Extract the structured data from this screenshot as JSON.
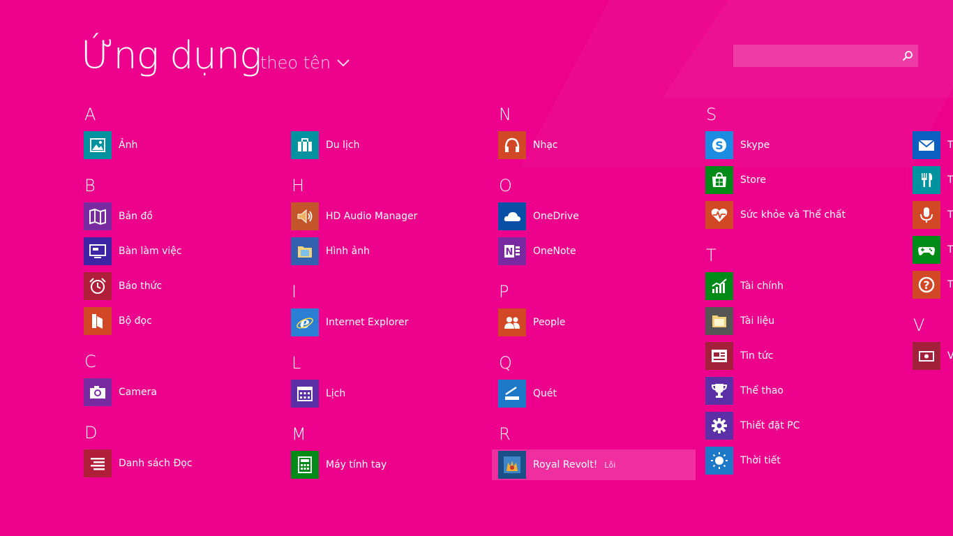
{
  "header": {
    "title": "Ứng dụng",
    "sort_label": "theo tên"
  },
  "search": {
    "value": "",
    "placeholder": ""
  },
  "columns": [
    {
      "groups": [
        {
          "letter": "A",
          "apps": [
            {
              "label": "Ảnh",
              "icon": "photos-icon",
              "color": "#00939f"
            }
          ]
        },
        {
          "letter": "B",
          "apps": [
            {
              "label": "Bản đồ",
              "icon": "maps-icon",
              "color": "#7a2aa0"
            },
            {
              "label": "Bàn làm việc",
              "icon": "desktop-icon",
              "color": "#3d24a4"
            },
            {
              "label": "Báo thức",
              "icon": "alarm-icon",
              "color": "#b01e3a"
            },
            {
              "label": "Bộ đọc",
              "icon": "reader-icon",
              "color": "#d24726"
            }
          ]
        },
        {
          "letter": "C",
          "apps": [
            {
              "label": "Camera",
              "icon": "camera-icon",
              "color": "#7a2aa0"
            }
          ]
        },
        {
          "letter": "D",
          "apps": [
            {
              "label": "Danh sách Đọc",
              "icon": "reading-list-icon",
              "color": "#b01e3a"
            }
          ]
        }
      ]
    },
    {
      "groups": [
        {
          "letter": "",
          "apps": [
            {
              "label": "Du lịch",
              "icon": "travel-icon",
              "color": "#00939f"
            }
          ]
        },
        {
          "letter": "H",
          "apps": [
            {
              "label": "HD Audio Manager",
              "icon": "speaker-icon",
              "color": "#c4542a"
            },
            {
              "label": "Hình ảnh",
              "icon": "pictures-folder-icon",
              "color": "#3361b0"
            }
          ]
        },
        {
          "letter": "I",
          "apps": [
            {
              "label": "Internet Explorer",
              "icon": "internet-explorer-icon",
              "color": "#2a7fd4"
            }
          ]
        },
        {
          "letter": "L",
          "apps": [
            {
              "label": "Lịch",
              "icon": "calendar-icon",
              "color": "#5b2fa6"
            }
          ]
        },
        {
          "letter": "M",
          "apps": [
            {
              "label": "Máy tính tay",
              "icon": "calculator-icon",
              "color": "#008a17"
            }
          ]
        }
      ]
    },
    {
      "groups": [
        {
          "letter": "N",
          "apps": [
            {
              "label": "Nhạc",
              "icon": "music-icon",
              "color": "#d24726"
            }
          ]
        },
        {
          "letter": "O",
          "apps": [
            {
              "label": "OneDrive",
              "icon": "onedrive-icon",
              "color": "#0a4fa6"
            },
            {
              "label": "OneNote",
              "icon": "onenote-icon",
              "color": "#7a2aa0"
            }
          ]
        },
        {
          "letter": "P",
          "apps": [
            {
              "label": "People",
              "icon": "people-icon",
              "color": "#d24726"
            }
          ]
        },
        {
          "letter": "Q",
          "apps": [
            {
              "label": "Quét",
              "icon": "scan-icon",
              "color": "#1e78c8"
            }
          ]
        },
        {
          "letter": "R",
          "apps": [
            {
              "label": "Royal Revolt!",
              "icon": "royal-revolt-icon",
              "color": "#1a4f88",
              "badge": "Lỗi",
              "selected": true
            }
          ]
        }
      ]
    },
    {
      "groups": [
        {
          "letter": "S",
          "apps": [
            {
              "label": "Skype",
              "icon": "skype-icon",
              "color": "#1c8ce0"
            },
            {
              "label": "Store",
              "icon": "store-icon",
              "color": "#008a17"
            },
            {
              "label": "Sức khỏe và Thể chất",
              "icon": "health-icon",
              "color": "#d24726"
            }
          ]
        },
        {
          "letter": "T",
          "apps": [
            {
              "label": "Tài chính",
              "icon": "finance-icon",
              "color": "#008a17"
            },
            {
              "label": "Tài liệu",
              "icon": "documents-folder-icon",
              "color": "#555555"
            },
            {
              "label": "Tin tức",
              "icon": "news-icon",
              "color": "#a3203a"
            },
            {
              "label": "Thể thao",
              "icon": "sports-icon",
              "color": "#5b2fa6"
            },
            {
              "label": "Thiết đặt PC",
              "icon": "settings-gear-icon",
              "color": "#5b2fa6"
            },
            {
              "label": "Thời tiết",
              "icon": "weather-icon",
              "color": "#1e78c8"
            }
          ]
        }
      ]
    },
    {
      "groups": [
        {
          "letter": "",
          "apps": [
            {
              "label": "T",
              "icon": "mail-icon",
              "color": "#0a5fc0"
            },
            {
              "label": "T",
              "icon": "food-icon",
              "color": "#00939f"
            },
            {
              "label": "T",
              "icon": "microphone-icon",
              "color": "#d24726"
            },
            {
              "label": "T",
              "icon": "games-icon",
              "color": "#008a17"
            },
            {
              "label": "T",
              "icon": "help-icon",
              "color": "#d24726"
            }
          ]
        },
        {
          "letter": "V",
          "apps": [
            {
              "label": "V",
              "icon": "video-icon",
              "color": "#a3203a"
            }
          ]
        }
      ]
    }
  ]
}
